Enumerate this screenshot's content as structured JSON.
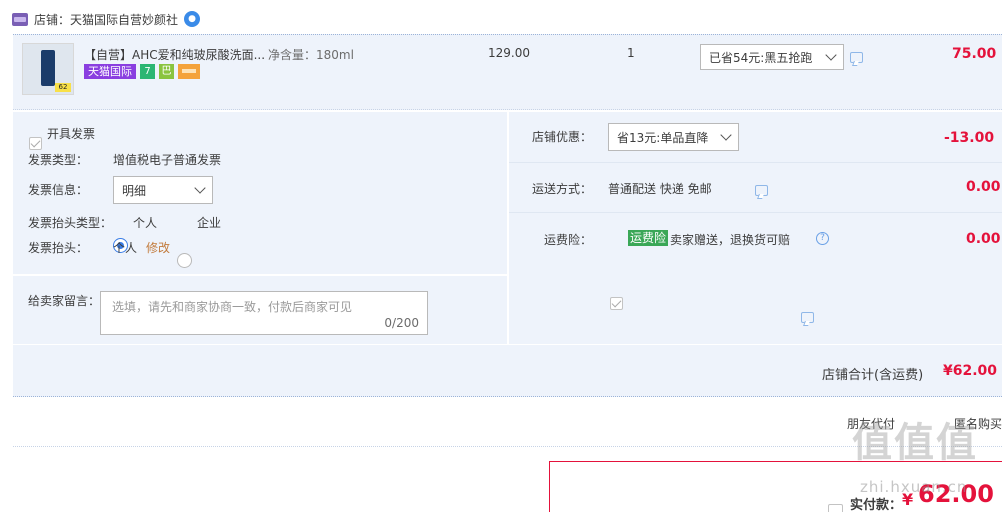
{
  "shop": {
    "label": "店铺：天猫国际自营妙颜社"
  },
  "item": {
    "title": "【自营】AHC爱和纯玻尿酸洗面...",
    "spec": "净含量：180ml",
    "badge_tmall": "天猫国际",
    "badge_7": "7",
    "badge_u": "巴",
    "thumb_tag": "62",
    "unit_price": "129.00",
    "quantity": "1",
    "promo": "已省54元:黑五抢跑",
    "total": "75.00"
  },
  "invoice": {
    "open_label": "开具发票",
    "type_label": "发票类型：",
    "type_value": "增值税电子普通发票",
    "info_label": "发票信息：",
    "info_value": "明细",
    "header_type_label": "发票抬头类型：",
    "option_personal": "个人",
    "option_company": "企业",
    "header_label": "发票抬头：",
    "header_value": "个人",
    "edit_link": "修改"
  },
  "message": {
    "label": "给卖家留言：",
    "placeholder": "选填，请先和商家协商一致，付款后商家可见",
    "count": "0/200"
  },
  "shop_discount": {
    "label": "店铺优惠：",
    "value": "省13元:单品直降",
    "amount": "-13.00"
  },
  "shipping": {
    "label": "运送方式：",
    "value": "普通配送 快递 免邮",
    "amount": "0.00"
  },
  "insurance": {
    "label": "运费险：",
    "tag": "运费险",
    "desc": "卖家赠送，退换货可赔",
    "amount": "0.00"
  },
  "store_total": {
    "label": "店铺合计(含运费)",
    "amount": "¥62.00"
  },
  "options": {
    "friend_pay": "朋友代付",
    "anonymous": "匿名购买"
  },
  "payment": {
    "label": "实付款：",
    "currency": "¥",
    "amount": "62.00"
  },
  "watermark": {
    "text": "值值值",
    "sub": "zhi.hxuan.cn"
  },
  "colors": {
    "accent_red": "#e4123b",
    "panel_bg": "#eef3fb",
    "brand_purple": "#8a3ee0",
    "check_blue": "#3a7de6"
  }
}
